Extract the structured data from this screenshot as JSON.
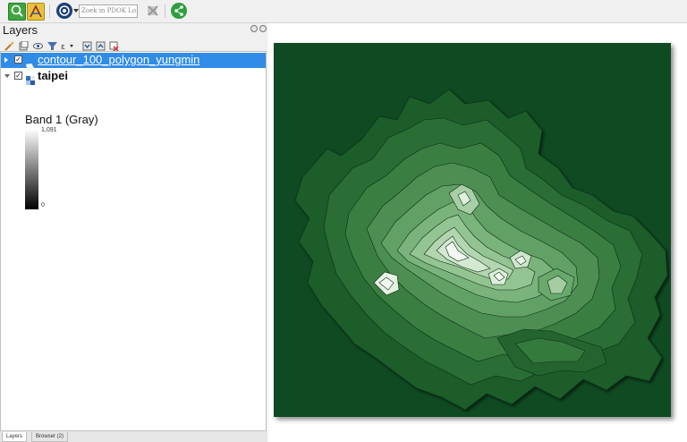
{
  "toolbar": {
    "search_placeholder": "Zoek in PDOK Lo…",
    "icons": [
      "identify-icon",
      "measure-icon",
      "pdok-icon",
      "dropdown-icon",
      "remove-icon",
      "share-icon"
    ]
  },
  "layers_panel": {
    "title": "Layers",
    "layers": [
      {
        "name": "contour_100_polygon_yungmin",
        "checked": "✓",
        "type": "vector-polygon",
        "selected": true
      },
      {
        "name": "taipei",
        "checked": "✓",
        "type": "raster",
        "selected": false
      }
    ],
    "legend": {
      "band_label": "Band 1 (Gray)",
      "max_value": "1,091",
      "min_value": "0"
    }
  },
  "bottom_tabs": [
    "Layers",
    "Browser (2)"
  ],
  "colors": {
    "selection": "#308ce6",
    "map_background": "#0f4a22",
    "accent_green": "#2e9e3e"
  }
}
